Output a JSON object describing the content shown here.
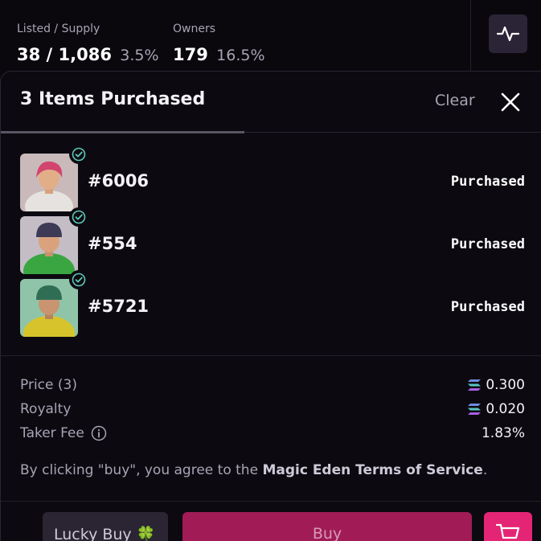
{
  "stats": {
    "listed_label": "Listed / Supply",
    "listed_value": "38 / 1,086",
    "listed_pct": "3.5%",
    "owners_label": "Owners",
    "owners_value": "179",
    "owners_pct": "16.5%"
  },
  "panel": {
    "title": "3 Items Purchased",
    "clear_label": "Clear"
  },
  "items": [
    {
      "name": "#6006",
      "status": "Purchased",
      "bg": "#c9b9ba",
      "hair": "#d2456e",
      "shirt": "#e6e2df"
    },
    {
      "name": "#554",
      "status": "Purchased",
      "bg": "#c4bdc6",
      "hair": "#3c3a55",
      "shirt": "#3aa642"
    },
    {
      "name": "#5721",
      "status": "Purchased",
      "bg": "#8fc4a8",
      "hair": "#2f6e55",
      "shirt": "#d7c42c"
    }
  ],
  "summary": {
    "price_label": "Price (3)",
    "price_value": "0.300",
    "royalty_label": "Royalty",
    "royalty_value": "0.020",
    "taker_fee_label": "Taker Fee",
    "taker_fee_value": "1.83%",
    "terms_prefix": "By clicking \"buy\", you agree to the ",
    "terms_link": "Magic Eden Terms of Service",
    "terms_suffix": "."
  },
  "footer": {
    "lucky_label": "Lucky Buy 🍀",
    "buy_label": "Buy"
  },
  "colors": {
    "accent": "#e42575",
    "buy_button": "#a11c57",
    "check_teal": "#5ec8b6"
  },
  "icons": [
    "activity-icon",
    "close-icon",
    "verified-check-icon",
    "solana-icon",
    "info-icon",
    "cart-icon"
  ]
}
